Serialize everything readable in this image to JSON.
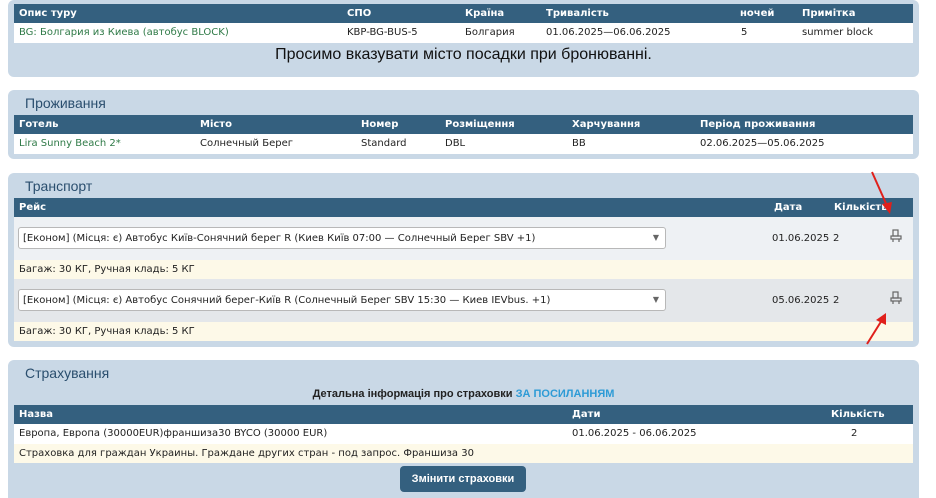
{
  "tour": {
    "headers": [
      "Опис туру",
      "СПО",
      "Країна",
      "Тривалість",
      "ночей",
      "Примітка"
    ],
    "row": {
      "name": "BG: Болгария из Киева (автобус BLOCK)",
      "spo": "KBP-BG-BUS-5",
      "country": "Болгария",
      "duration": "01.06.2025—06.06.2025",
      "nights": "5",
      "note": "summer block"
    },
    "notice": "Просимо вказувати місто посадки при бронюванні."
  },
  "accommodation": {
    "title": "Проживання",
    "headers": [
      "Готель",
      "Місто",
      "Номер",
      "Розміщення",
      "Харчування",
      "Період проживання"
    ],
    "row": {
      "hotel": "Lira Sunny Beach 2*",
      "city": "Солнечный Берег",
      "room": "Standard",
      "placement": "DBL",
      "meal": "BB",
      "period": "02.06.2025—05.06.2025"
    }
  },
  "transport": {
    "title": "Транспорт",
    "headers": {
      "trip": "Рейс",
      "date": "Дата",
      "count": "Кількість"
    },
    "rows": [
      {
        "select": "[Економ] (Місця: є) Автобус Київ-Сонячний берег R (Киев Київ 07:00 — Солнечный Берег SBV +1)",
        "date": "01.06.2025",
        "count": "2",
        "baggage": "Багаж: 30 КГ, Ручная кладь: 5 КГ"
      },
      {
        "select": "[Економ] (Місця: є) Автобус Сонячний берег-Київ R (Солнечный Берег SBV 15:30 — Киев IEVbus. +1)",
        "date": "05.06.2025",
        "count": "2",
        "baggage": "Багаж: 30 КГ, Ручная кладь: 5 КГ"
      }
    ],
    "seat_icon": "bus-seat-icon",
    "annotation_color": "#e0201b"
  },
  "insurance": {
    "title": "Страхування",
    "info_text": "Детальна інформація про страховки",
    "info_link": "ЗА ПОСИЛАННЯМ",
    "headers": {
      "name": "Назва",
      "dates": "Дати",
      "count": "Кількість"
    },
    "row": {
      "name": "Европа, Европа (30000EUR)франшиза30 BYCO (30000 EUR)",
      "dates": "01.06.2025 - 06.06.2025",
      "count": "2",
      "note": "Страховка для граждан Украины. Граждане других стран - под запрос. Франшиза 30"
    },
    "change_button": "Змінити страховки"
  }
}
